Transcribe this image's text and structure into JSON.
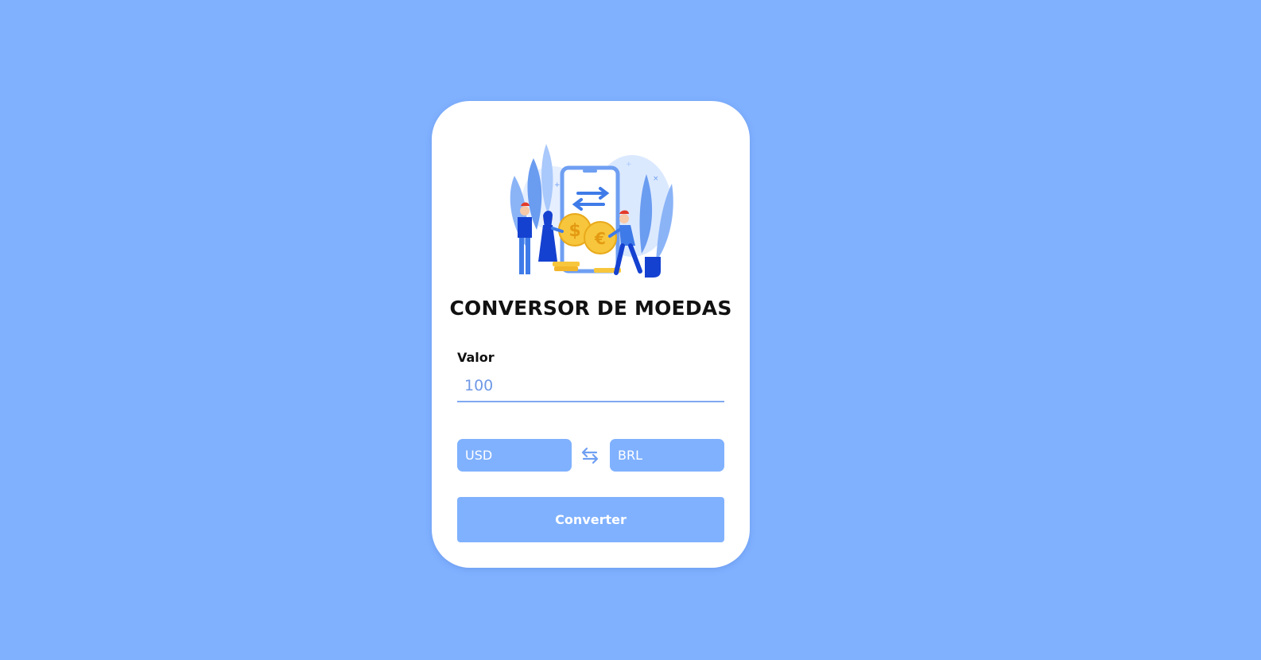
{
  "converter": {
    "title": "CONVERSOR DE MOEDAS",
    "amount_label": "Valor",
    "amount_value": "100",
    "from_currency": "USD",
    "to_currency": "BRL",
    "convert_label": "Converter"
  },
  "icons": {
    "swap": "swap-arrows-icon",
    "illustration": "currency-exchange-illustration"
  },
  "colors": {
    "background": "#80b1ff",
    "card": "#ffffff",
    "accent": "#80b1ff",
    "input_text": "#6f98e6"
  }
}
